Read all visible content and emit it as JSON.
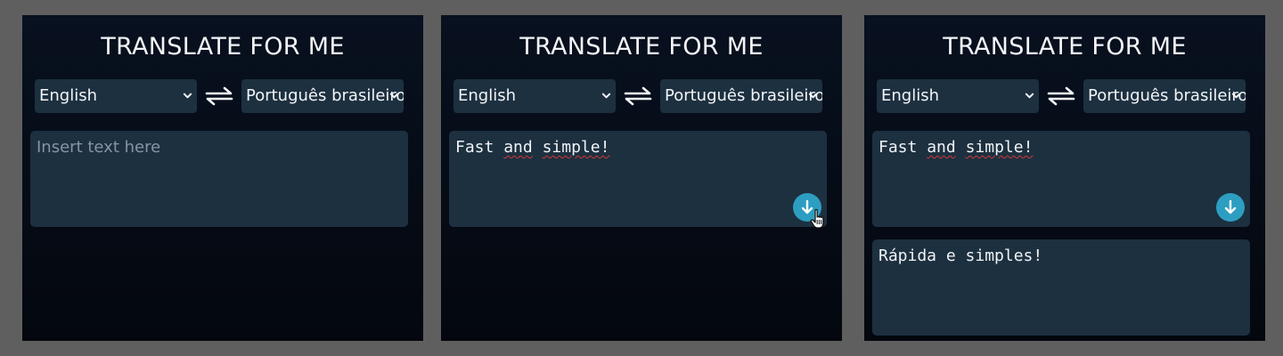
{
  "app": {
    "title": "TRANSLATE FOR ME"
  },
  "languages": {
    "source": "English",
    "target": "Português brasileiro"
  },
  "panels": [
    {
      "input_placeholder": "Insert text here",
      "input_value": ""
    },
    {
      "input_value": "Fast and simple!"
    },
    {
      "input_value": "Fast and simple!",
      "output_value": "Rápida e simples!"
    }
  ],
  "icons": {
    "swap": "swap-arrows-icon",
    "translate": "arrow-down-icon",
    "dropdown": "chevron-down-icon",
    "cursor": "hand-pointer-icon"
  },
  "colors": {
    "page_background": "#5f5f5f",
    "panel_background": "#050a14",
    "field_background": "#1d3040",
    "accent": "#2d9ec1",
    "text": "#f2f4f7",
    "placeholder": "#8595a6"
  }
}
